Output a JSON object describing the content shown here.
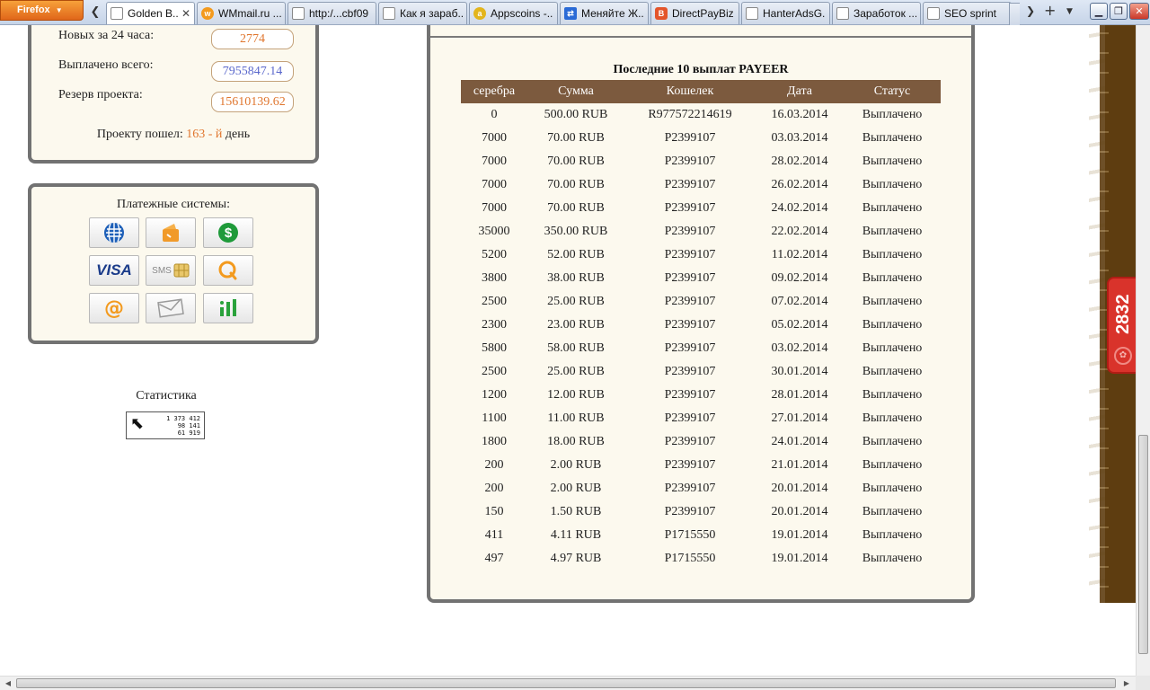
{
  "browser": {
    "menu_label": "Firefox",
    "tabs": [
      {
        "title": "Golden B...",
        "favicon": "blank-page-icon",
        "active": true
      },
      {
        "title": "WMmail.ru ...",
        "favicon": "wmmail-icon"
      },
      {
        "title": "http:/...cbf09",
        "favicon": "blank-page-icon"
      },
      {
        "title": "Как я зараб...",
        "favicon": "blank-page-icon"
      },
      {
        "title": "Appscoins -...",
        "favicon": "appscoins-icon"
      },
      {
        "title": "Меняйте Ж...",
        "favicon": "exchange-icon"
      },
      {
        "title": "DirectPayBiz",
        "favicon": "blogger-icon"
      },
      {
        "title": "HanterAdsG...",
        "favicon": "blank-page-icon"
      },
      {
        "title": "Заработок ...",
        "favicon": "blank-page-icon"
      },
      {
        "title": "SEO sprint",
        "favicon": "blank-page-icon"
      }
    ]
  },
  "stats": {
    "new24_label": "Новых за 24 часа:",
    "new24_value": "2774",
    "paid_label": "Выплачено всего:",
    "paid_value": "7955847.14",
    "reserve_label": "Резерв проекта:",
    "reserve_value": "15610139.62",
    "age_prefix": "Проекту пошел:",
    "age_value": "163 - й",
    "age_suffix": "день"
  },
  "payments": {
    "title": "Платежные системы:",
    "buttons": [
      "webmoney-icon",
      "yandex-wallet-icon",
      "dollar-coin-icon",
      "visa-icon",
      "sms-icon",
      "qiwi-icon",
      "mail-at-icon",
      "envelope-icon",
      "bars-icon"
    ],
    "visa_text": "VISA",
    "sms_text": "SMS"
  },
  "statistics": {
    "caption": "Статистика",
    "counter_lines": [
      "1 373 412",
      "98 141",
      "61 919"
    ]
  },
  "payouts": {
    "title": "Последние 10 выплат PAYEER",
    "headers": [
      "серебра",
      "Сумма",
      "Кошелек",
      "Дата",
      "Статус"
    ],
    "rows": [
      [
        "0",
        "500.00 RUB",
        "R977572214619",
        "16.03.2014",
        "Выплачено"
      ],
      [
        "7000",
        "70.00 RUB",
        "P2399107",
        "03.03.2014",
        "Выплачено"
      ],
      [
        "7000",
        "70.00 RUB",
        "P2399107",
        "28.02.2014",
        "Выплачено"
      ],
      [
        "7000",
        "70.00 RUB",
        "P2399107",
        "26.02.2014",
        "Выплачено"
      ],
      [
        "7000",
        "70.00 RUB",
        "P2399107",
        "24.02.2014",
        "Выплачено"
      ],
      [
        "35000",
        "350.00 RUB",
        "P2399107",
        "22.02.2014",
        "Выплачено"
      ],
      [
        "5200",
        "52.00 RUB",
        "P2399107",
        "11.02.2014",
        "Выплачено"
      ],
      [
        "3800",
        "38.00 RUB",
        "P2399107",
        "09.02.2014",
        "Выплачено"
      ],
      [
        "2500",
        "25.00 RUB",
        "P2399107",
        "07.02.2014",
        "Выплачено"
      ],
      [
        "2300",
        "23.00 RUB",
        "P2399107",
        "05.02.2014",
        "Выплачено"
      ],
      [
        "5800",
        "58.00 RUB",
        "P2399107",
        "03.02.2014",
        "Выплачено"
      ],
      [
        "2500",
        "25.00 RUB",
        "P2399107",
        "30.01.2014",
        "Выплачено"
      ],
      [
        "1200",
        "12.00 RUB",
        "P2399107",
        "28.01.2014",
        "Выплачено"
      ],
      [
        "1100",
        "11.00 RUB",
        "P2399107",
        "27.01.2014",
        "Выплачено"
      ],
      [
        "1800",
        "18.00 RUB",
        "P2399107",
        "24.01.2014",
        "Выплачено"
      ],
      [
        "200",
        "2.00 RUB",
        "P2399107",
        "21.01.2014",
        "Выплачено"
      ],
      [
        "200",
        "2.00 RUB",
        "P2399107",
        "20.01.2014",
        "Выплачено"
      ],
      [
        "150",
        "1.50 RUB",
        "P2399107",
        "20.01.2014",
        "Выплачено"
      ],
      [
        "411",
        "4.11 RUB",
        "P1715550",
        "19.01.2014",
        "Выплачено"
      ],
      [
        "497",
        "4.97 RUB",
        "P1715550",
        "19.01.2014",
        "Выплачено"
      ]
    ]
  },
  "side_badge": {
    "count": "2832"
  },
  "colors": {
    "accent_orange": "#e0762e",
    "value_blue": "#5a68cc",
    "table_header": "#7c5a3e",
    "panel_bg": "#fcf9ee",
    "badge_red": "#d9332b"
  }
}
